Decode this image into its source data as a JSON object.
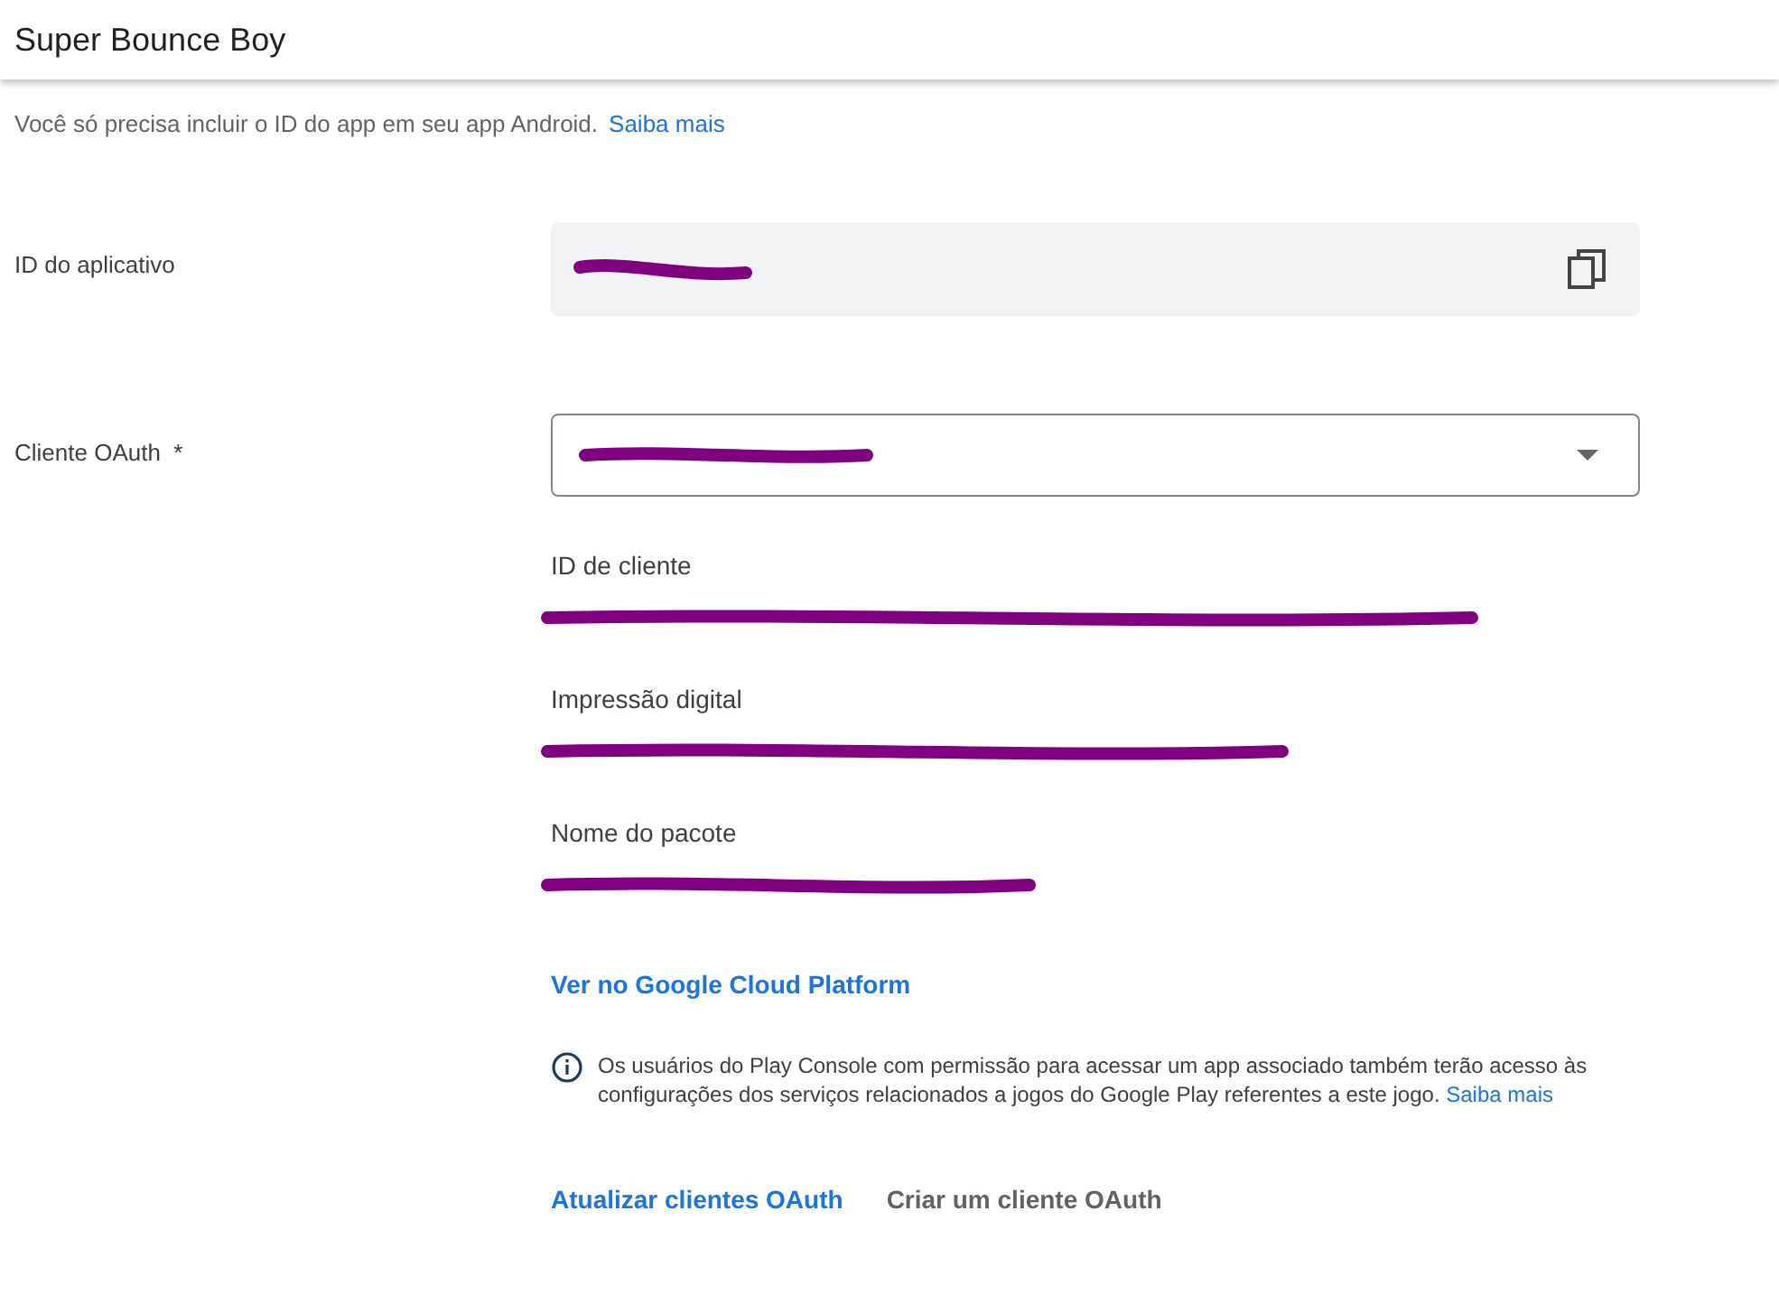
{
  "header": {
    "title": "Super Bounce Boy"
  },
  "intro": {
    "text": "Você só precisa incluir o ID do app em seu app Android.",
    "link": "Saiba mais"
  },
  "app_id": {
    "label": "ID do aplicativo",
    "redacted": true
  },
  "oauth": {
    "label": "Cliente OAuth",
    "required_mark": "*",
    "redacted": true
  },
  "details": [
    {
      "label": "ID de cliente",
      "redacted": true
    },
    {
      "label": "Impressão digital",
      "redacted": true
    },
    {
      "label": "Nome do pacote",
      "redacted": true
    }
  ],
  "cloud_link": "Ver no Google Cloud Platform",
  "notice": {
    "text": "Os usuários do Play Console com permissão para acessar um app associado também terão acesso às configurações dos serviços relacionados a jogos do Google Play referentes a este jogo.",
    "link": "Saiba mais"
  },
  "actions": [
    {
      "label": "Atualizar clientes OAuth",
      "kind": "primary"
    },
    {
      "label": "Criar um cliente OAuth",
      "kind": "secondary"
    }
  ]
}
